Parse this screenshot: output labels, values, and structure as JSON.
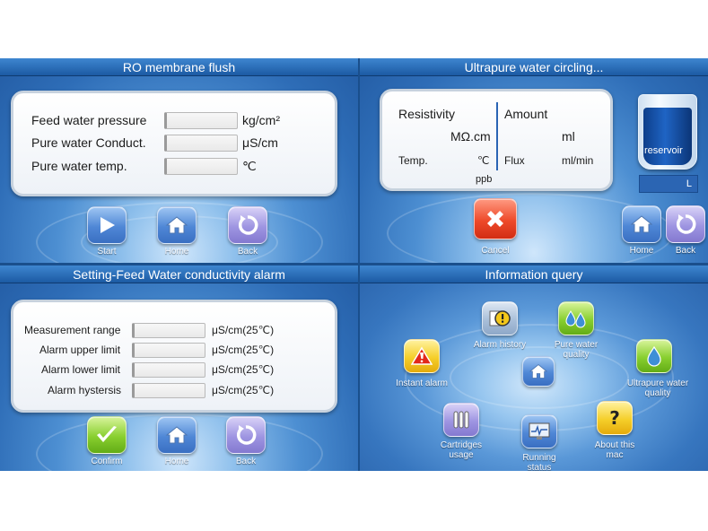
{
  "ro_flush": {
    "title": "RO membrane flush",
    "rows": [
      {
        "label": "Feed water pressure",
        "unit": "kg/cm²"
      },
      {
        "label": "Pure water Conduct.",
        "unit": "μS/cm"
      },
      {
        "label": "Pure water temp.",
        "unit": "℃"
      }
    ],
    "buttons": {
      "start": "Start",
      "home": "Home",
      "back": "Back"
    }
  },
  "circling": {
    "title": "Ultrapure water circling...",
    "resistivity_label": "Resistivity",
    "resistivity_unit": "MΩ.cm",
    "amount_label": "Amount",
    "amount_unit": "ml",
    "temp_label": "Temp.",
    "temp_unit": "℃",
    "flux_label": "Flux",
    "flux_unit": "ml/min",
    "ppb_unit": "ppb",
    "reservoir_label": "reservoir",
    "reservoir_unit": "L",
    "buttons": {
      "cancel": "Cancel",
      "home": "Home",
      "back": "Back"
    }
  },
  "alarm_setting": {
    "title": "Setting-Feed Water conductivity alarm",
    "rows": [
      {
        "label": "Measurement range",
        "unit": "μS/cm(25℃)"
      },
      {
        "label": "Alarm upper limit",
        "unit": "μS/cm(25℃)"
      },
      {
        "label": "Alarm lower limit",
        "unit": "μS/cm(25℃)"
      },
      {
        "label": "Alarm hystersis",
        "unit": "μS/cm(25℃)"
      }
    ],
    "buttons": {
      "confirm": "Confirm",
      "home": "Home",
      "back": "Back"
    }
  },
  "info_query": {
    "title": "Information query",
    "items": {
      "alarm_history": "Alarm history",
      "pure_water_quality": "Pure water quality",
      "instant_alarm": "Instant alarm",
      "ultrapure_water_quality": "Ultrapure water quality",
      "cartridges_usage": "Cartridges usage",
      "running_status": "Running status",
      "about": "About this mac"
    }
  },
  "colors": {
    "title_bar": "#1c5aa3",
    "accent_blue": "#4f87d6",
    "cancel_red": "#ee4a2a",
    "confirm_green": "#88cf2f"
  }
}
